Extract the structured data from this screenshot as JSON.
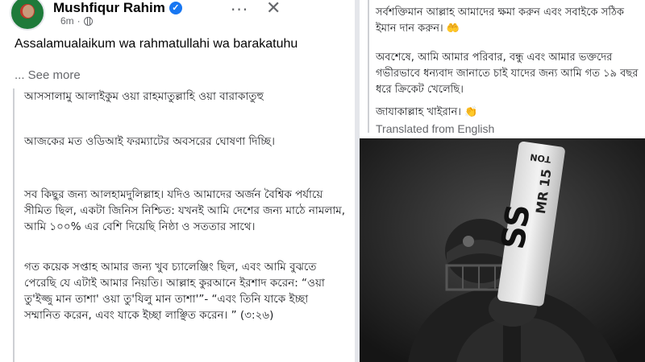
{
  "post": {
    "author": "Mushfiqur Rahim",
    "time": "6m",
    "more_label": "···",
    "close_label": "✕",
    "text": "Assalamualaikum wa rahmatullahi wa barakatuhu",
    "see_more": "... See more",
    "translated_label": "Translated from English"
  },
  "translation_left": [
    "আসসালামু আলাইকুম ওয়া রাহমাতুল্লাহি ওয়া বারাকাতুহু",
    "আজকের মত ওডিআই ফরম্যাটের অবসরের ঘোষণা দিচ্ছি।",
    "সব কিছুর জন্য আলহামদুলিল্লাহ। যদিও আমাদের অর্জন বৈশ্বিক পর্যায়ে সীমিত ছিল, একটা জিনিস নিশ্চিত: যখনই আমি দেশের জন্য মাঠে নামলাম, আমি ১০০% এর বেশি দিয়েছি নিষ্ঠা ও সততার সাথে।",
    "গত কয়েক সপ্তাহ আমার জন্য খুব চ্যালেঞ্জিং ছিল, এবং আমি বুঝতে পেরেছি যে এটাই আমার নিয়তি। আল্লাহ কুরআনে ইরশাদ করেন: “ওয়া তু'ইজ্জু মান তাশা' ওয়া তু'যিলু মান তাশা'”- “এবং তিনি যাকে ইচ্ছা সম্মানিত করেন, এবং যাকে ইচ্ছা লাঞ্ছিত করেন। ” (৩:২৬)"
  ],
  "translation_right": [
    "সর্বশক্তিমান আল্লাহ আমাদের ক্ষমা করুন এবং সবাইকে সঠিক ইমান দান করুন। 🤲",
    "অবশেষে, আমি আমার পরিবার, বন্ধু এবং আমার ভক্তদের গভীরভাবে ধন্যবাদ জানাতে চাই যাদের জন্য আমি গত ১৯ বছর ধরে ক্রিকেট খেলেছি।",
    "জাযাকাল্লাহ খাইরান। 👏"
  ],
  "photo": {
    "bat_brand": "SS",
    "bat_model": "MR 15",
    "bat_top": "TON"
  },
  "colors": {
    "verified": "#1877f2",
    "meta_grey": "#65676b",
    "divider": "#e4e6eb"
  }
}
